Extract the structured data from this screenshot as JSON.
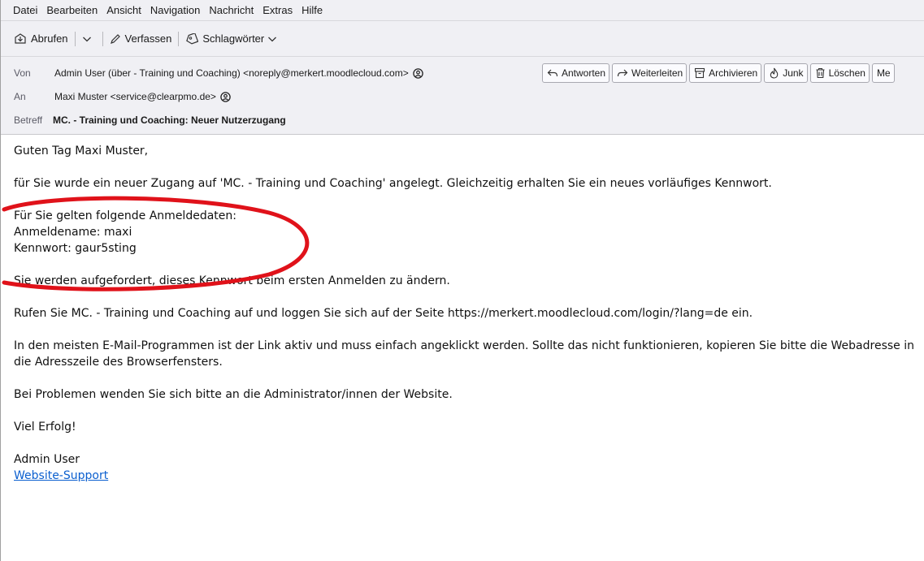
{
  "menubar": {
    "items": [
      {
        "label": "Datei"
      },
      {
        "label": "Bearbeiten"
      },
      {
        "label": "Ansicht"
      },
      {
        "label": "Navigation"
      },
      {
        "label": "Nachricht"
      },
      {
        "label": "Extras"
      },
      {
        "label": "Hilfe"
      }
    ]
  },
  "toolbar": {
    "fetch_label": "Abrufen",
    "compose_label": "Verfassen",
    "tags_label": "Schlagwörter"
  },
  "header": {
    "from_label": "Von",
    "from_value": "Admin User (über - Training und Coaching) <noreply@merkert.moodlecloud.com>",
    "to_label": "An",
    "to_value": "Maxi Muster <service@clearpmo.de>",
    "subject_label": "Betreff",
    "subject_value": "MC. - Training und Coaching: Neuer Nutzerzugang",
    "actions": {
      "reply": "Antworten",
      "forward": "Weiterleiten",
      "archive": "Archivieren",
      "junk": "Junk",
      "delete": "Löschen",
      "more": "Me"
    }
  },
  "body": {
    "greeting": "Guten Tag Maxi Muster,",
    "intro": "für Sie wurde ein neuer Zugang auf 'MC. - Training und Coaching' angelegt. Gleichzeitig erhalten Sie ein neues vorläufiges Kennwort.",
    "credentials_heading": "Für Sie gelten folgende Anmeldedaten:",
    "username_line": "Anmeldename: maxi",
    "password_line": "Kennwort: gaur5sting",
    "change_notice": "Sie werden aufgefordert, dieses Kennwort beim ersten Anmelden zu ändern.",
    "login_instruction": "Rufen Sie MC. - Training und Coaching auf und loggen Sie sich auf der Seite https://merkert.moodlecloud.com/login/?lang=de ein.",
    "link_notice": "In den meisten E-Mail-Programmen ist der Link aktiv und muss einfach angeklickt werden. Sollte das nicht funktionieren, kopieren Sie bitte die Webadresse in die Adresszeile des Browserfensters.",
    "problems": "Bei Problemen wenden Sie sich bitte an die Administrator/innen der Website.",
    "closing": "Viel Erfolg!",
    "signature_name": "Admin User",
    "support_link": "Website-Support"
  },
  "colors": {
    "annotation_ellipse": "#e0121a",
    "link": "#0b5fcf",
    "chrome_background": "#f0f0f4"
  }
}
